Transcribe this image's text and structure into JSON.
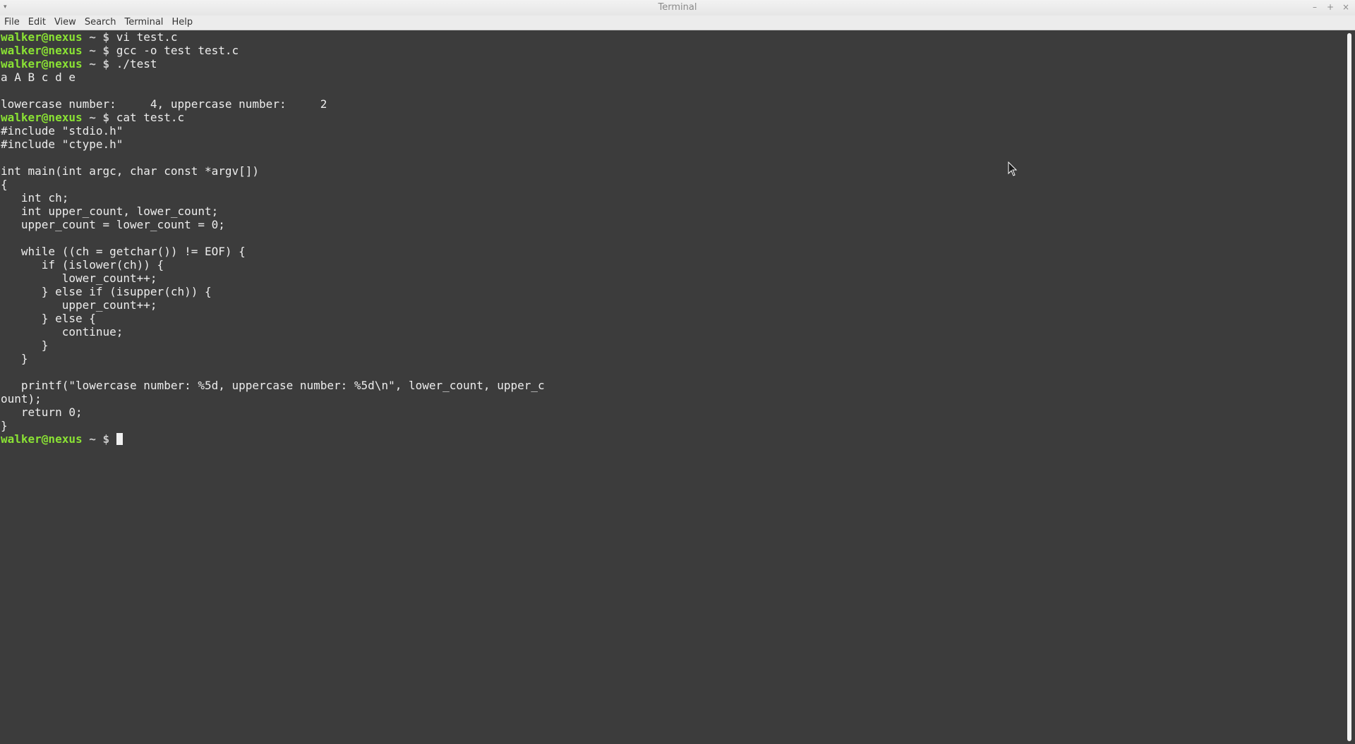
{
  "window": {
    "title": "Terminal",
    "controls": [
      "–",
      "+",
      "×"
    ]
  },
  "menubar": {
    "items": [
      "File",
      "Edit",
      "View",
      "Search",
      "Terminal",
      "Help"
    ]
  },
  "prompt": {
    "user": "walker@nexus",
    "rest": " ~ $ "
  },
  "terminal_lines": [
    {
      "type": "prompt",
      "cmd": "vi test.c"
    },
    {
      "type": "prompt",
      "cmd": "gcc -o test test.c"
    },
    {
      "type": "prompt",
      "cmd": "./test"
    },
    {
      "type": "out",
      "text": "a A B c d e"
    },
    {
      "type": "out",
      "text": ""
    },
    {
      "type": "out",
      "text": "lowercase number:     4, uppercase number:     2"
    },
    {
      "type": "prompt",
      "cmd": "cat test.c"
    },
    {
      "type": "out",
      "text": "#include \"stdio.h\""
    },
    {
      "type": "out",
      "text": "#include \"ctype.h\""
    },
    {
      "type": "out",
      "text": ""
    },
    {
      "type": "out",
      "text": "int main(int argc, char const *argv[])"
    },
    {
      "type": "out",
      "text": "{"
    },
    {
      "type": "out",
      "text": "   int ch;"
    },
    {
      "type": "out",
      "text": "   int upper_count, lower_count;"
    },
    {
      "type": "out",
      "text": "   upper_count = lower_count = 0;"
    },
    {
      "type": "out",
      "text": ""
    },
    {
      "type": "out",
      "text": "   while ((ch = getchar()) != EOF) {"
    },
    {
      "type": "out",
      "text": "      if (islower(ch)) {"
    },
    {
      "type": "out",
      "text": "         lower_count++;"
    },
    {
      "type": "out",
      "text": "      } else if (isupper(ch)) {"
    },
    {
      "type": "out",
      "text": "         upper_count++;"
    },
    {
      "type": "out",
      "text": "      } else {"
    },
    {
      "type": "out",
      "text": "         continue;"
    },
    {
      "type": "out",
      "text": "      }"
    },
    {
      "type": "out",
      "text": "   }"
    },
    {
      "type": "out",
      "text": ""
    },
    {
      "type": "out",
      "text": "   printf(\"lowercase number: %5d, uppercase number: %5d\\n\", lower_count, upper_c"
    },
    {
      "type": "out",
      "text": "ount);"
    },
    {
      "type": "out",
      "text": "   return 0;"
    },
    {
      "type": "out",
      "text": "}"
    },
    {
      "type": "prompt",
      "cmd": "",
      "cursor": true
    }
  ],
  "colors": {
    "background": "#3c3c3c",
    "prompt_user": "#8ae234",
    "text": "#ededed"
  }
}
